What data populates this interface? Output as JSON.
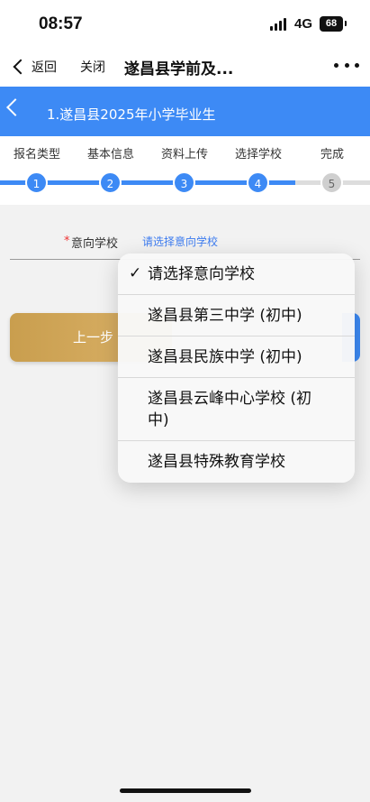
{
  "status_bar": {
    "time": "08:57",
    "network": "4G",
    "battery": "68"
  },
  "nav": {
    "back_label": "返回",
    "close_label": "关闭",
    "title": "遂昌县学前及..."
  },
  "header": {
    "title": "1.遂昌县2025年小学毕业生"
  },
  "steps": {
    "items": [
      {
        "label": "报名类型",
        "number": "1"
      },
      {
        "label": "基本信息",
        "number": "2"
      },
      {
        "label": "资料上传",
        "number": "3"
      },
      {
        "label": "选择学校",
        "number": "4"
      },
      {
        "label": "完成",
        "number": "5"
      }
    ],
    "current": 4
  },
  "form": {
    "required_mark": "*",
    "school_label": "意向学校",
    "school_placeholder": "请选择意向学校"
  },
  "buttons": {
    "prev_label": "上一步"
  },
  "dropdown": {
    "options": [
      {
        "label": "请选择意向学校",
        "selected": true
      },
      {
        "label": "遂昌县第三中学 (初中)",
        "selected": false
      },
      {
        "label": "遂昌县民族中学 (初中)",
        "selected": false
      },
      {
        "label": "遂昌县云峰中心学校 (初中)",
        "selected": false
      },
      {
        "label": "遂昌县特殊教育学校",
        "selected": false
      }
    ],
    "check_glyph": "✓"
  },
  "colors": {
    "primary": "#3d8af5",
    "gold": "#c99e4e"
  }
}
